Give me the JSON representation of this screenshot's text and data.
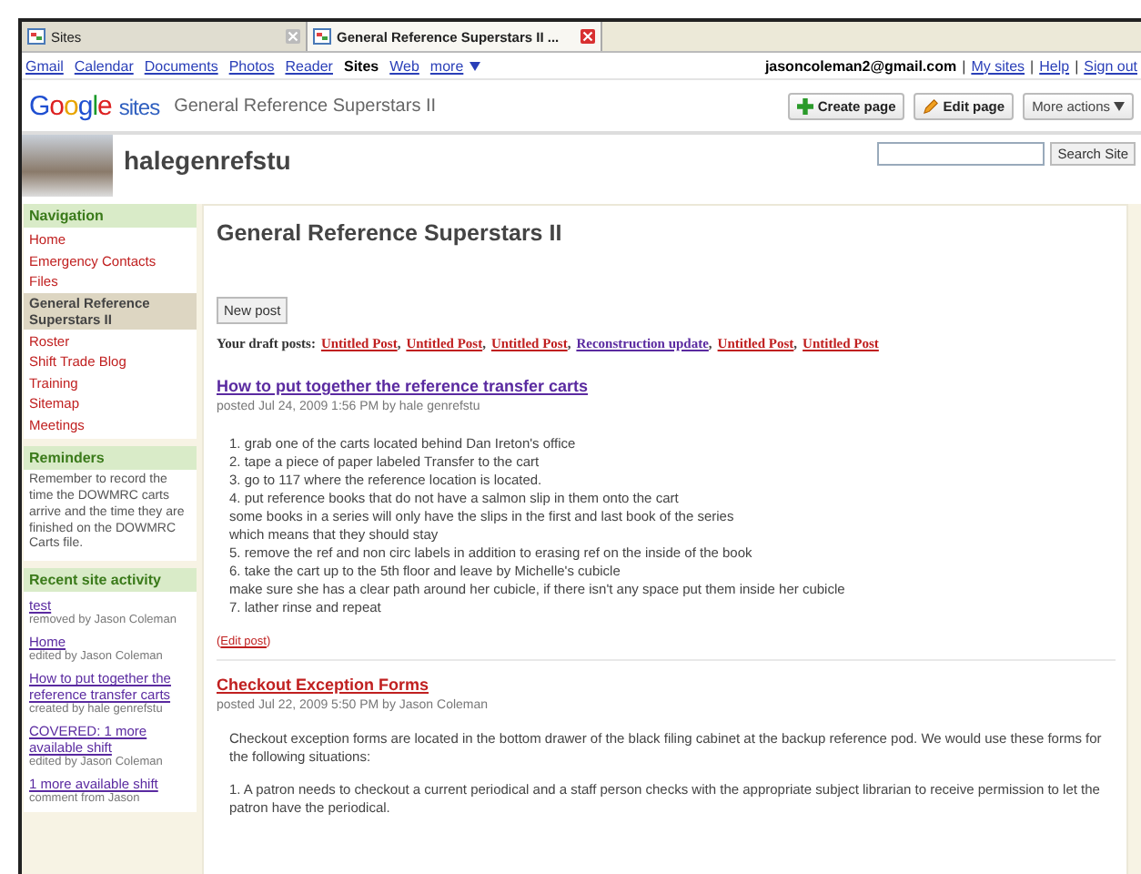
{
  "browser_tabs": [
    {
      "title": "Sites",
      "selected": false
    },
    {
      "title": "General Reference Superstars II ...",
      "selected": true
    }
  ],
  "google_bar": {
    "links": [
      {
        "label": "Gmail",
        "selected": false
      },
      {
        "label": "Calendar",
        "selected": false
      },
      {
        "label": "Documents",
        "selected": false
      },
      {
        "label": "Photos",
        "selected": false
      },
      {
        "label": "Reader",
        "selected": false
      },
      {
        "label": "Sites",
        "selected": true
      },
      {
        "label": "Web",
        "selected": false
      },
      {
        "label": "more",
        "selected": false
      }
    ],
    "account": "jasoncoleman2@gmail.com",
    "account_links": [
      "My sites",
      "Help",
      "Sign out"
    ],
    "separator": "|"
  },
  "header": {
    "logo_google": "Google",
    "logo_sites": "sites",
    "site_title": "General Reference Superstars II",
    "buttons": [
      {
        "label": "Create page",
        "kind": "create"
      },
      {
        "label": "Edit page",
        "kind": "edit"
      },
      {
        "label": "More actions",
        "kind": "menu"
      }
    ]
  },
  "site": {
    "name": "halegenrefstu",
    "search_button": "Search Site"
  },
  "sidebar": {
    "navigation": {
      "title": "Navigation",
      "items": [
        {
          "label": "Home",
          "selected": false
        },
        {
          "label": "Emergency Contacts",
          "selected": false
        },
        {
          "label": "Files",
          "selected": false
        },
        {
          "label": "General Reference Superstars II",
          "selected": true
        },
        {
          "label": "Roster",
          "selected": false
        },
        {
          "label": "Shift Trade Blog",
          "selected": false
        },
        {
          "label": "Training",
          "selected": false
        },
        {
          "label": "Sitemap",
          "selected": false
        },
        {
          "label": "Meetings",
          "selected": false
        }
      ]
    },
    "reminders": {
      "title": "Reminders",
      "text": "Remember to record the time the DOWMRC carts arrive and the time they are finished on the DOWMRC Carts file."
    },
    "recent": {
      "title": "Recent site activity",
      "items": [
        {
          "link": "test",
          "meta": "removed by Jason Coleman"
        },
        {
          "link": "Home",
          "meta": "edited by Jason Coleman"
        },
        {
          "link": "How to put together the reference transfer carts",
          "meta": "created by hale genrefstu"
        },
        {
          "link": "COVERED: 1 more available shift",
          "meta": "edited by Jason Coleman"
        },
        {
          "link": "1 more available shift",
          "meta": "comment from Jason"
        }
      ]
    }
  },
  "page": {
    "title": "General Reference Superstars II",
    "new_post": "New post",
    "drafts_label": "Your draft posts:",
    "drafts": [
      {
        "label": "Untitled Post",
        "visited": false
      },
      {
        "label": "Untitled Post",
        "visited": false
      },
      {
        "label": "Untitled Post",
        "visited": false
      },
      {
        "label": "Reconstruction update",
        "visited": true
      },
      {
        "label": "Untitled Post",
        "visited": false
      },
      {
        "label": "Untitled Post",
        "visited": false
      }
    ],
    "draft_separator": ",",
    "posts": [
      {
        "title": "How to put together the reference transfer carts",
        "visited": true,
        "posted": "posted Jul 24, 2009 1:56 PM by hale genrefstu",
        "lines": [
          "1.  grab one of the carts located behind Dan Ireton's office",
          "2.  tape a piece of paper labeled Transfer to the cart",
          "3.  go to 117 where the reference location is located.",
          "4.  put reference books that do not have a salmon slip in them onto the cart",
          "some books in a series will only have the slips in the first and last book of the series",
          "which means that they should stay",
          "5.  remove the ref and non circ labels in addition to erasing ref on the inside of the book",
          "6.  take the cart up to the 5th floor and leave by Michelle's cubicle",
          "make sure she has a clear path around her cubicle, if there isn't any space put them inside her cubicle",
          "7. lather rinse and repeat"
        ],
        "edit_link": {
          "before": "(",
          "label": "Edit post",
          "after": ")"
        }
      },
      {
        "title": "Checkout Exception Forms",
        "visited": false,
        "posted": "posted Jul 22, 2009 5:50 PM by Jason Coleman",
        "paragraphs": [
          "Checkout exception forms are located in the bottom drawer of the black filing cabinet at the backup reference pod. We would use these forms for the following situations:",
          "1. A patron needs to checkout a current periodical and a staff person checks with the appropriate subject librarian to receive permission to let the patron have the periodical."
        ]
      }
    ]
  }
}
